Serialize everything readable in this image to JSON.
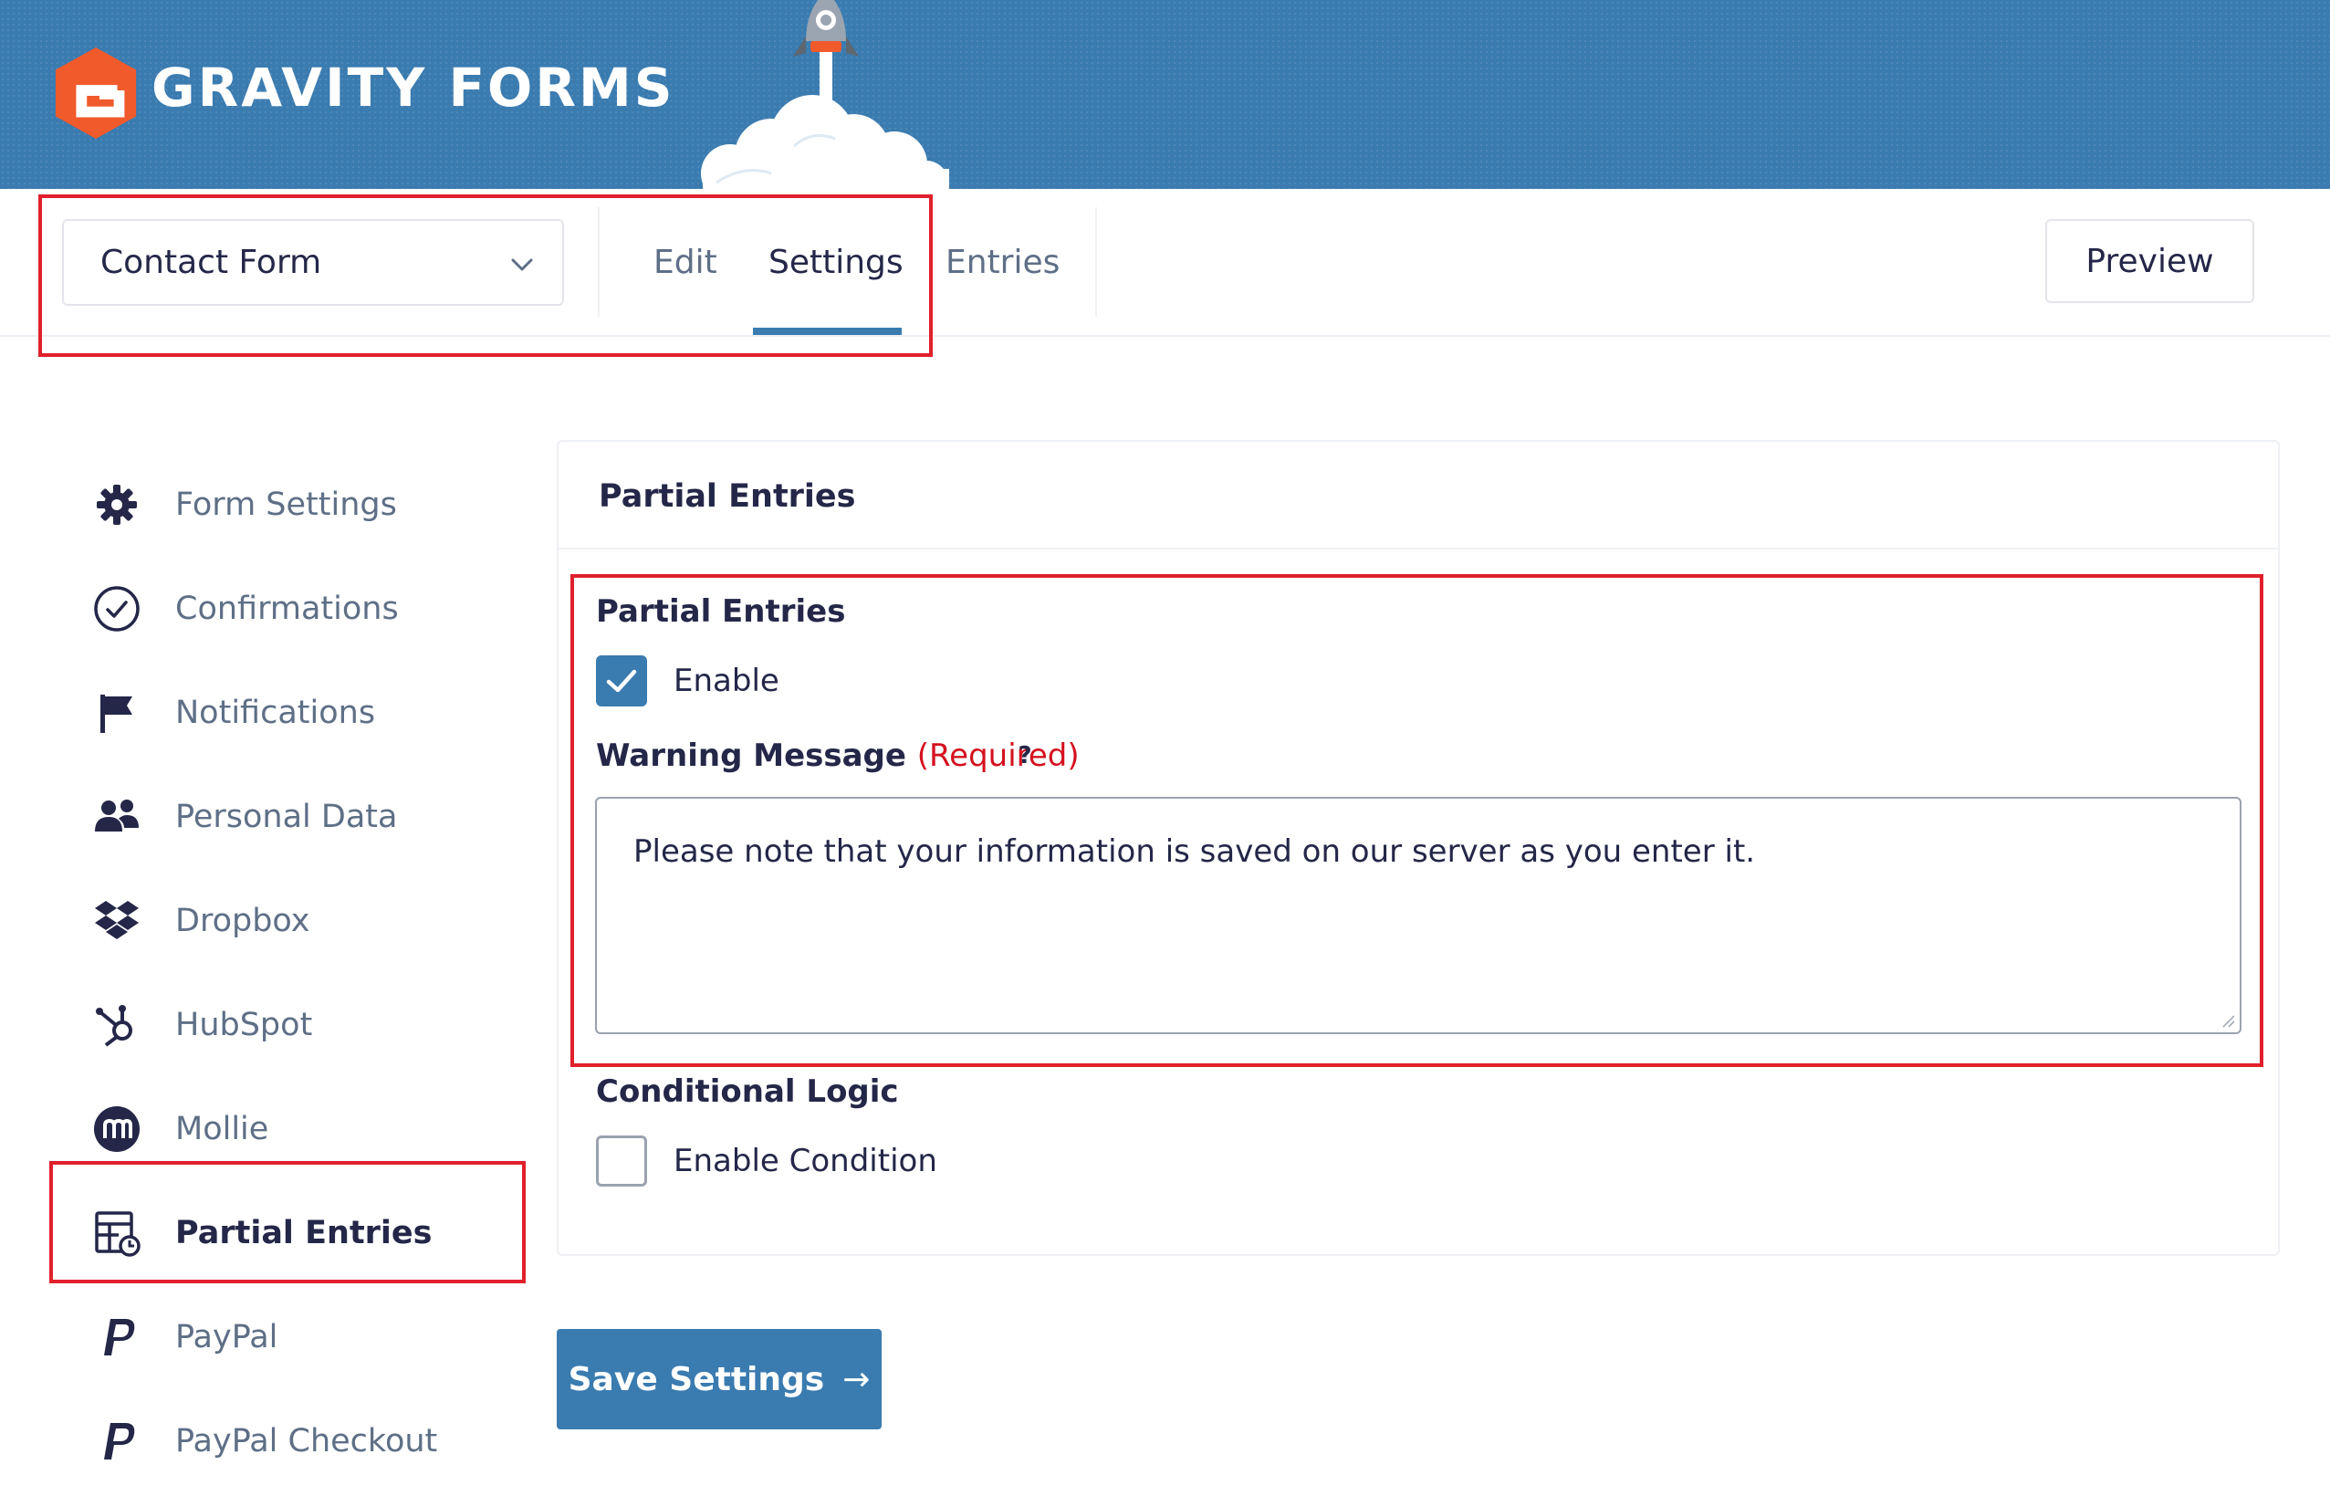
{
  "brand": {
    "name": "GRAVITY FORMS",
    "color": "#3a7bb0",
    "logo_color": "#f15a2b"
  },
  "nav": {
    "form_select": "Contact Form",
    "tabs": [
      {
        "label": "Edit",
        "active": false
      },
      {
        "label": "Settings",
        "active": true
      },
      {
        "label": "Entries",
        "active": false
      }
    ],
    "preview_label": "Preview"
  },
  "sidebar": {
    "items": [
      {
        "label": "Form Settings",
        "icon": "gear-icon"
      },
      {
        "label": "Confirmations",
        "icon": "check-circle-icon"
      },
      {
        "label": "Notifications",
        "icon": "flag-icon"
      },
      {
        "label": "Personal Data",
        "icon": "people-icon"
      },
      {
        "label": "Dropbox",
        "icon": "dropbox-icon"
      },
      {
        "label": "HubSpot",
        "icon": "hubspot-icon"
      },
      {
        "label": "Mollie",
        "icon": "mollie-icon"
      },
      {
        "label": "Partial Entries",
        "icon": "partial-entries-icon",
        "active": true
      },
      {
        "label": "PayPal",
        "icon": "paypal-icon"
      },
      {
        "label": "PayPal Checkout",
        "icon": "paypal-icon"
      }
    ]
  },
  "panel": {
    "title": "Partial Entries",
    "partial_entries": {
      "label": "Partial Entries",
      "enable_label": "Enable",
      "enabled": true
    },
    "warning": {
      "label": "Warning Message",
      "required": "(Required)",
      "help": "?",
      "value": "Please note that your information is saved on our server as you enter it."
    },
    "conditional": {
      "label": "Conditional Logic",
      "enable_label": "Enable Condition",
      "enabled": false
    }
  },
  "save_button": {
    "label": "Save Settings",
    "arrow": "→"
  },
  "highlight_color": "#e0202b"
}
